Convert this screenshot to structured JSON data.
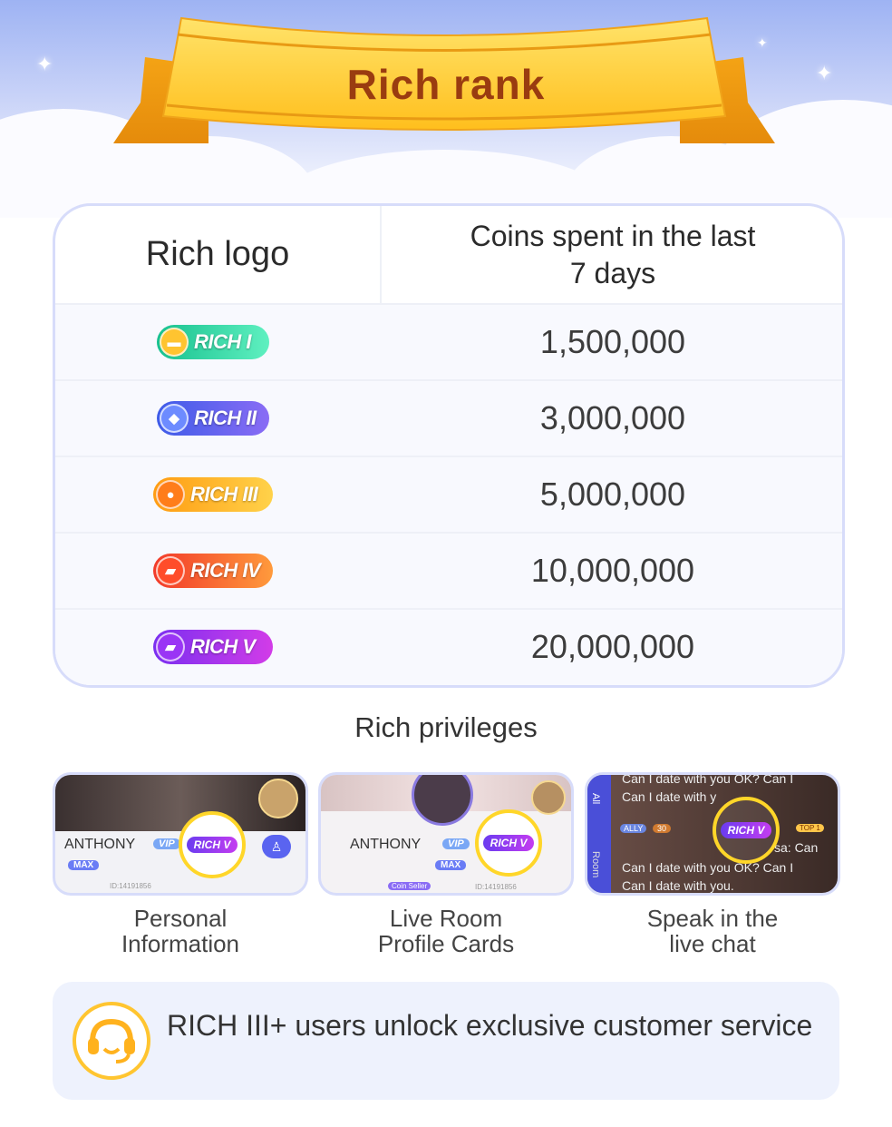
{
  "header": {
    "title": "Rich rank"
  },
  "table": {
    "col_logo": "Rich logo",
    "col_coins": "Coins spent in the last 7 days",
    "rows": [
      {
        "badge": "RICH I",
        "coins": "1,500,000",
        "color": "#2fd3a0"
      },
      {
        "badge": "RICH II",
        "coins": "3,000,000",
        "color": "#5b7cf2"
      },
      {
        "badge": "RICH III",
        "coins": "5,000,000",
        "color": "#ffae18"
      },
      {
        "badge": "RICH IV",
        "coins": "10,000,000",
        "color": "#ff5a2d"
      },
      {
        "badge": "RICH V",
        "coins": "20,000,000",
        "color": "#a43cf0"
      }
    ]
  },
  "privileges": {
    "title": "Rich privileges",
    "items": [
      {
        "caption": "Personal Information",
        "name": "ANTHONY",
        "vip": "VIP",
        "max": "MAX",
        "id": "ID:14191856"
      },
      {
        "caption": "Live Room Profile Cards",
        "name": "ANTHONY",
        "vip": "VIP",
        "max": "MAX",
        "seller": "Coin Seller",
        "id": "ID:14191856"
      },
      {
        "caption": "Speak in the live chat",
        "tab_all": "All",
        "tab_room": "Room",
        "chat_lines": [
          "Can I date with you OK? Can I",
          "Can I date with y",
          "Can I date with you OK? Can I",
          "Can I date with you."
        ],
        "ally": "ALLY",
        "level": "30",
        "top": "TOP 1",
        "partial": "sa: Can"
      }
    ],
    "magnifier_badge": "RICH V"
  },
  "service": {
    "text": "RICH III+ users unlock exclusive customer service",
    "icon": "headset-icon",
    "accent": "#ffb21e"
  }
}
